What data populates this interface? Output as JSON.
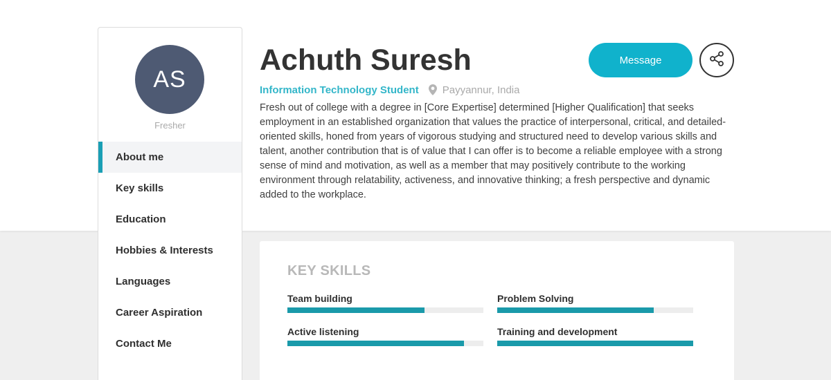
{
  "profile": {
    "initials": "AS",
    "status": "Fresher",
    "name": "Achuth Suresh",
    "role": "Information Technology Student",
    "location": "Payyannur, India",
    "bio": "Fresh out of college with a degree in [Core Expertise] determined [Higher Qualification] that seeks employment in an established organization that values the practice of interpersonal, critical, and detailed-oriented skills, honed from years of vigorous studying and structured need to develop various skills and talent, another contribution that is of value that I can offer is to become a reliable employee with a strong sense of mind and motivation, as well as a member that may positively contribute to the working environment through relatability, activeness, and innovative thinking; a fresh perspective and dynamic added to the workplace."
  },
  "actions": {
    "message_label": "Message",
    "share_icon": "share-icon"
  },
  "sidebar": {
    "items": [
      {
        "label": "About me",
        "active": true
      },
      {
        "label": "Key skills",
        "active": false
      },
      {
        "label": "Education",
        "active": false
      },
      {
        "label": "Hobbies & Interests",
        "active": false
      },
      {
        "label": "Languages",
        "active": false
      },
      {
        "label": "Career Aspiration",
        "active": false
      },
      {
        "label": "Contact Me",
        "active": false
      }
    ]
  },
  "key_skills": {
    "title": "KEY SKILLS",
    "skills": [
      {
        "name": "Team building",
        "level": 0.7
      },
      {
        "name": "Problem Solving",
        "level": 0.8
      },
      {
        "name": "Active listening",
        "level": 0.9
      },
      {
        "name": "Training and development",
        "level": 1.0
      }
    ]
  },
  "colors": {
    "accent": "#10b2cc",
    "avatar_bg": "#4e5a73",
    "bar_fill": "#1a9aaa",
    "role_text": "#33b6c9"
  }
}
